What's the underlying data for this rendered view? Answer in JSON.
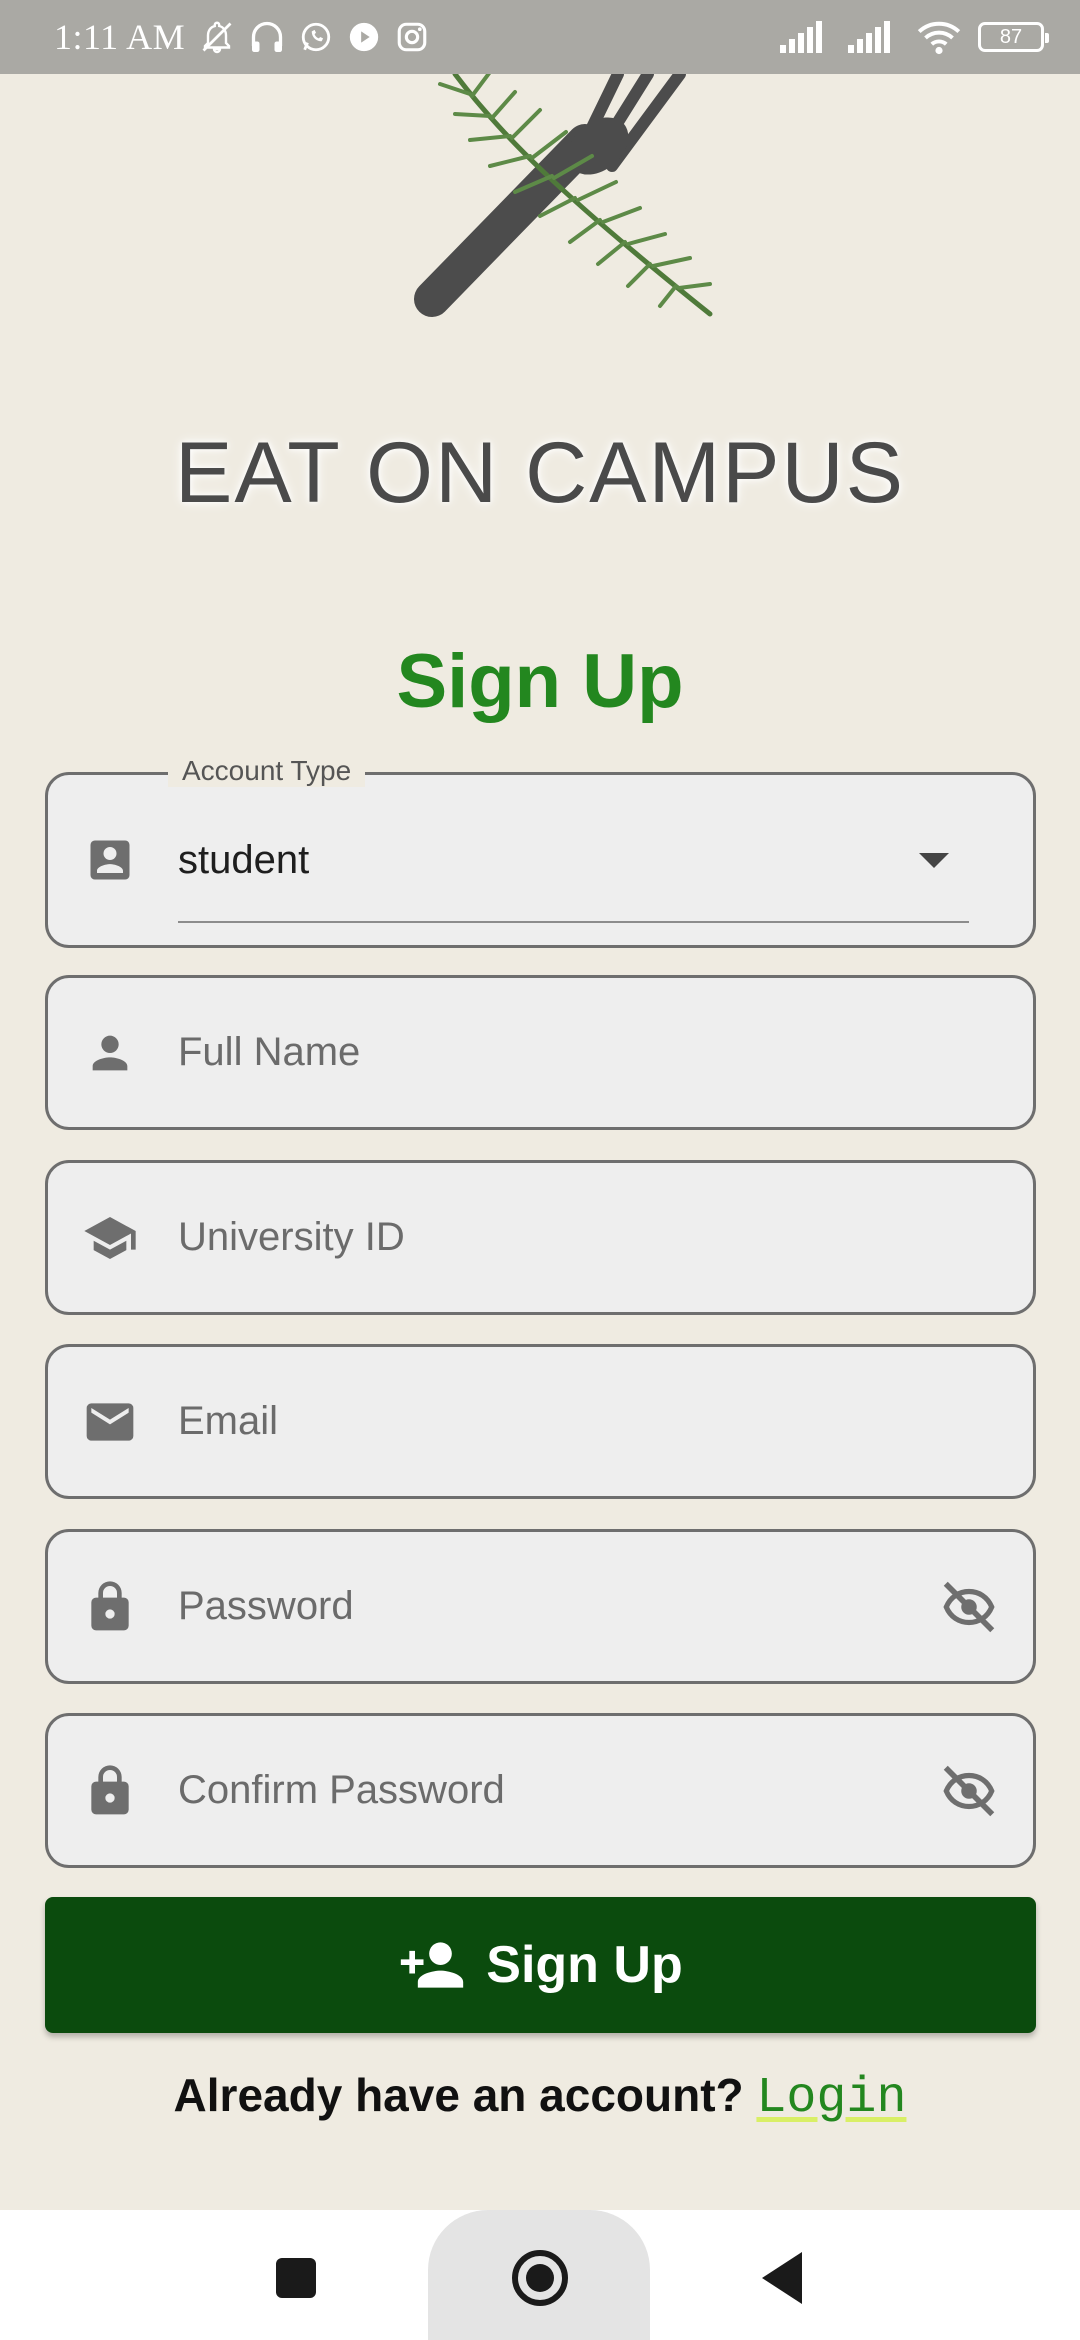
{
  "status_bar": {
    "time": "1:11 AM",
    "battery": "87",
    "icons": [
      "mute-icon",
      "headphones-icon",
      "whatsapp-icon",
      "youtube-icon",
      "instagram-icon",
      "signal-icon",
      "signal-icon",
      "wifi-icon",
      "battery-icon"
    ]
  },
  "logo": {
    "text": "EAT ON CAMPUS"
  },
  "page": {
    "title": "Sign Up"
  },
  "form": {
    "account_type": {
      "label": "Account Type",
      "value": "student",
      "icon": "account-box-icon"
    },
    "full_name": {
      "placeholder": "Full Name",
      "icon": "person-icon"
    },
    "university_id": {
      "placeholder": "University ID",
      "icon": "school-icon"
    },
    "email": {
      "placeholder": "Email",
      "icon": "mail-icon"
    },
    "password": {
      "placeholder": "Password",
      "icon": "lock-icon",
      "toggle_icon": "visibility-off-icon"
    },
    "confirm_password": {
      "placeholder": "Confirm Password",
      "icon": "lock-icon",
      "toggle_icon": "visibility-off-icon"
    },
    "submit_label": "Sign Up"
  },
  "footer": {
    "prompt": "Already have an account?",
    "link": "Login"
  },
  "colors": {
    "background": "#efebe1",
    "title_green": "#23871f",
    "button_green": "#0b4b0d",
    "status_bar": "#aaa9a4"
  }
}
